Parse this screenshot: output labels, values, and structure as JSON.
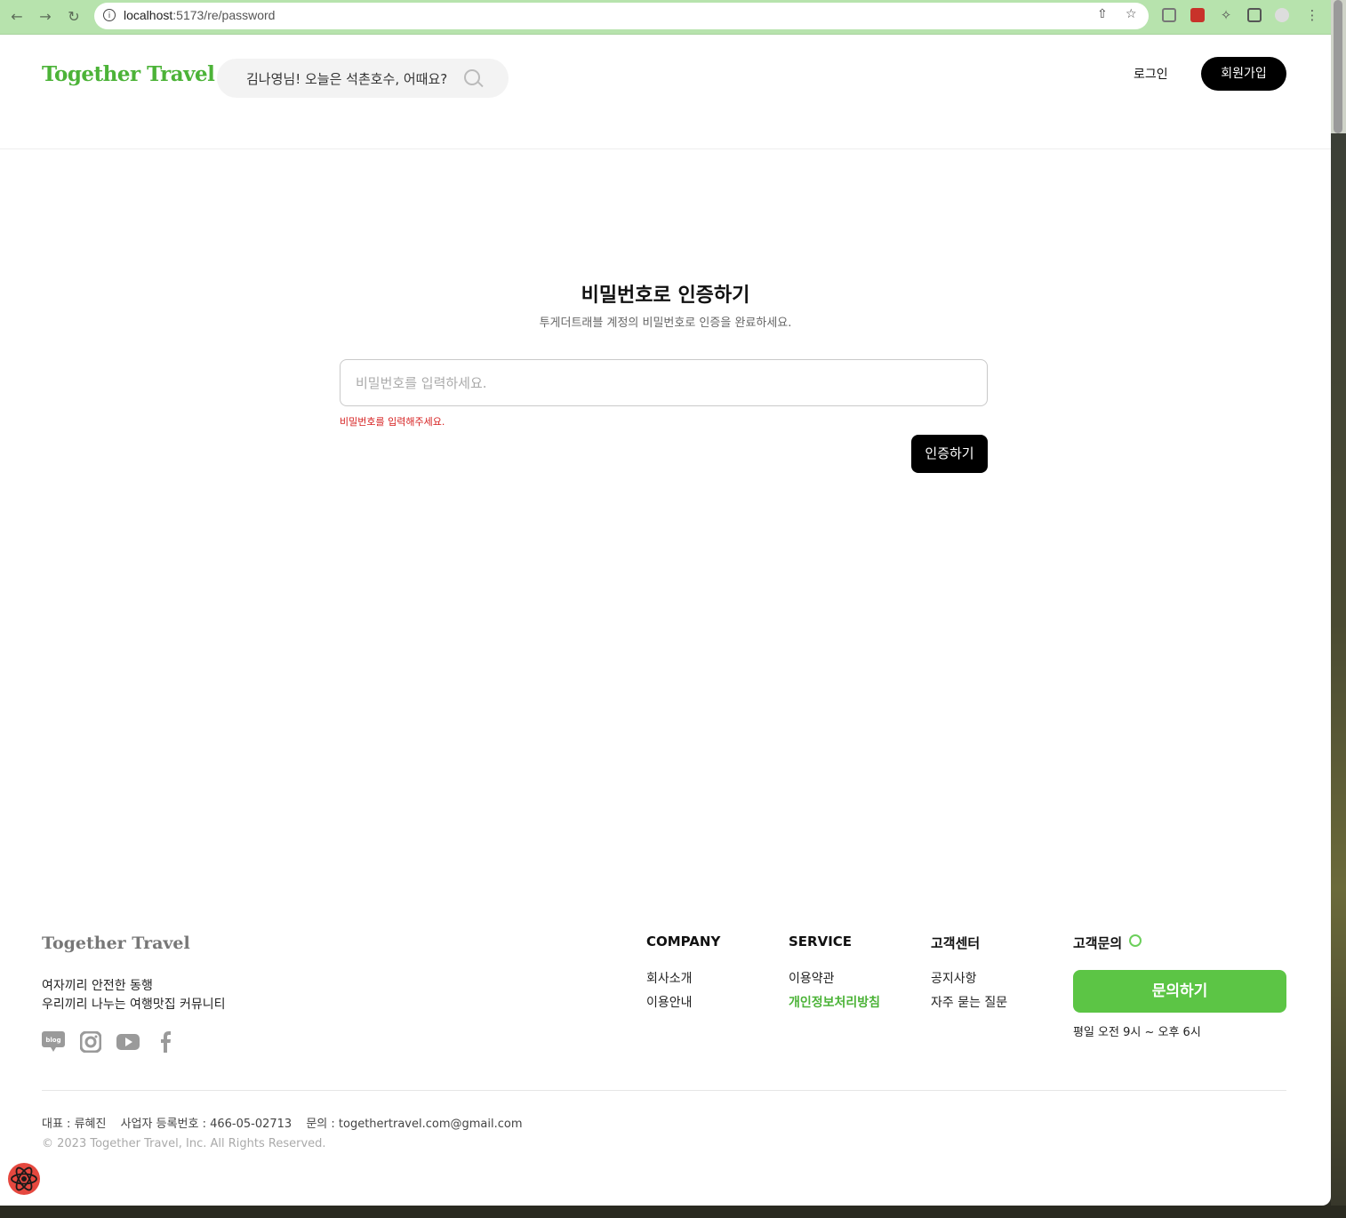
{
  "browser": {
    "url_host": "localhost",
    "url_path": ":5173/re/password"
  },
  "header": {
    "logo": "Together Travel",
    "search_text": "김나영님! 오늘은 석촌호수, 어때요?",
    "login": "로그인",
    "signup": "회원가입"
  },
  "main": {
    "title": "비밀번호로 인증하기",
    "subtitle": "투게더트래블 계정의 비밀번호로 인증을 완료하세요.",
    "password_placeholder": "비밀번호를 입력하세요.",
    "error": "비밀번호를 입력해주세요.",
    "verify_button": "인증하기"
  },
  "footer": {
    "logo": "Together Travel",
    "tagline_1": "여자끼리 안전한 동행",
    "tagline_2": "우리끼리 나누는 여행맛집 커뮤니티",
    "social_icons": [
      "blog-icon",
      "instagram-icon",
      "youtube-icon",
      "facebook-icon"
    ],
    "columns": [
      {
        "heading": "COMPANY",
        "items": [
          "회사소개",
          "이용안내"
        ]
      },
      {
        "heading": "SERVICE",
        "items": [
          "이용약관",
          "개인정보처리방침"
        ]
      },
      {
        "heading": "고객센터",
        "items": [
          "공지사항",
          "자주 묻는 질문"
        ]
      }
    ],
    "contact_heading": "고객문의",
    "inquiry_button": "문의하기",
    "hours": "평일 오전 9시 ~ 오후 6시",
    "ceo": "대표 : 류혜진",
    "business_no": "사업자 등록번호 : 466-05-02713",
    "contact": "문의 : togethertravel.com@gmail.com",
    "copyright": "© 2023 Together Travel, Inc. All Rights Reserved."
  },
  "colors": {
    "brand_green": "#4cb338",
    "button_black": "#000000",
    "error_red": "#d62020"
  }
}
